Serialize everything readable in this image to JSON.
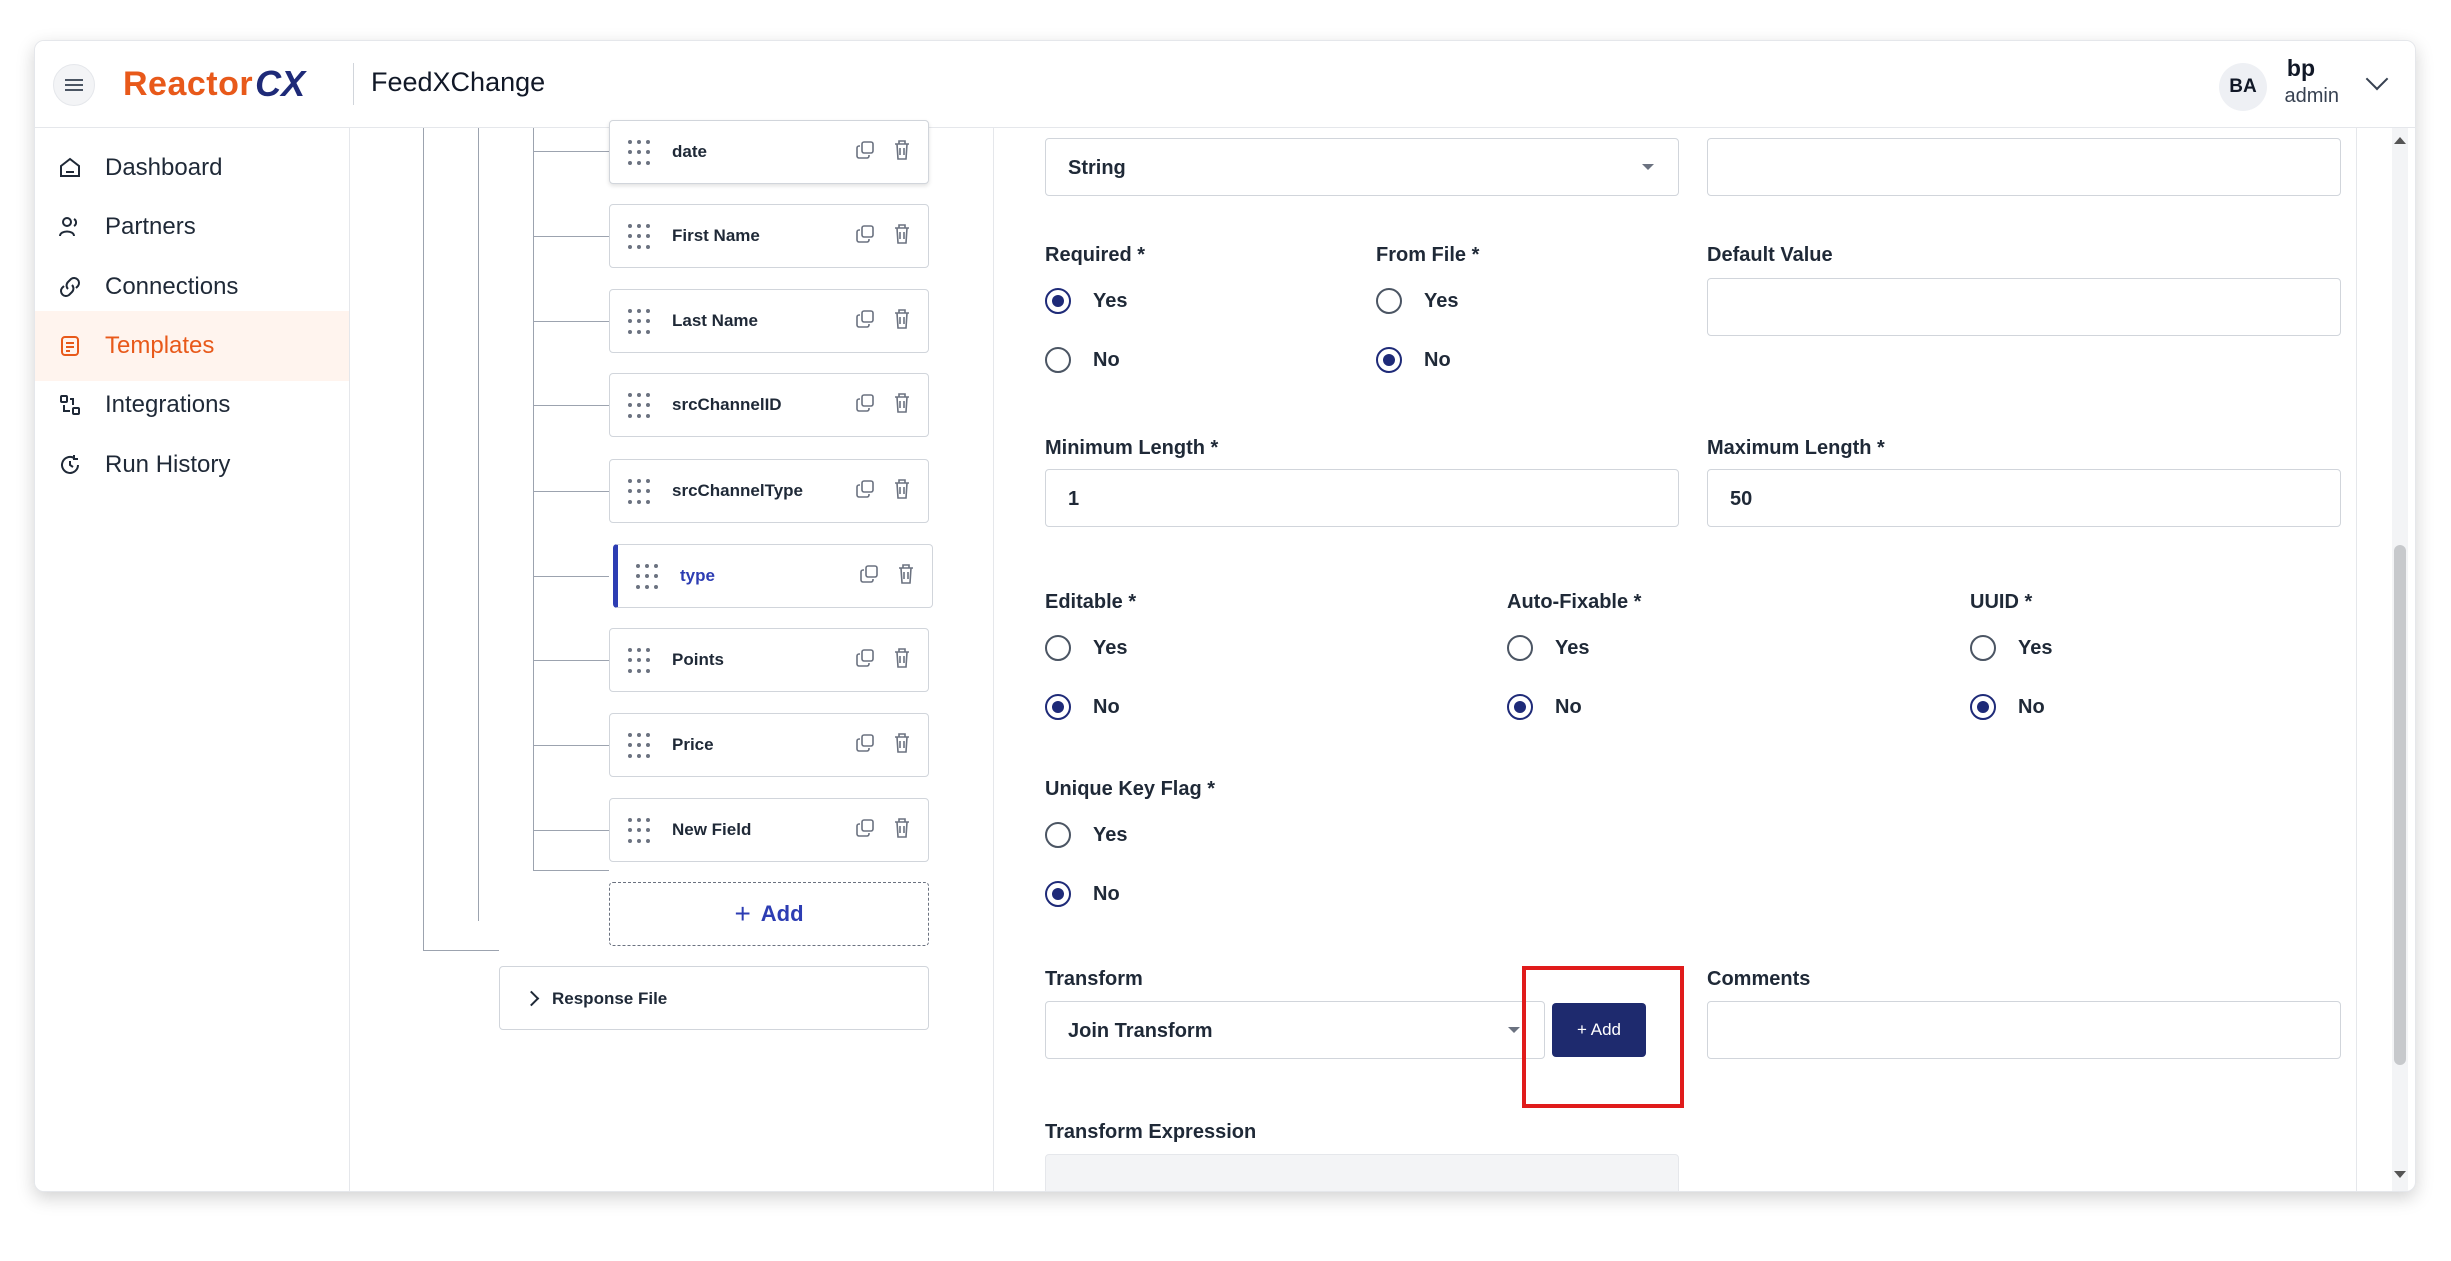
{
  "header": {
    "logo_word": "Reactor",
    "logo_cx": "CX",
    "app_title": "FeedXChange",
    "avatar_initials": "BA",
    "user_name": "bp",
    "user_role": "admin"
  },
  "sidebar": {
    "items": [
      {
        "label": "Dashboard",
        "icon": "home-icon",
        "active": false
      },
      {
        "label": "Partners",
        "icon": "users-icon",
        "active": false
      },
      {
        "label": "Connections",
        "icon": "link-icon",
        "active": false
      },
      {
        "label": "Templates",
        "icon": "template-icon",
        "active": true
      },
      {
        "label": "Integrations",
        "icon": "integrations-icon",
        "active": false
      },
      {
        "label": "Run History",
        "icon": "history-icon",
        "active": false
      }
    ]
  },
  "tree": {
    "fields": [
      {
        "name": "date"
      },
      {
        "name": "First Name"
      },
      {
        "name": "Last Name"
      },
      {
        "name": "srcChannelID"
      },
      {
        "name": "srcChannelType"
      },
      {
        "name": "type",
        "selected": true
      },
      {
        "name": "Points"
      },
      {
        "name": "Price"
      },
      {
        "name": "New Field"
      }
    ],
    "add_label": "Add",
    "response_file_label": "Response File"
  },
  "form": {
    "data_type_value": "String",
    "required": {
      "label": "Required *",
      "yes": "Yes",
      "no": "No",
      "selected": "Yes"
    },
    "from_file": {
      "label": "From File *",
      "yes": "Yes",
      "no": "No",
      "selected": "No"
    },
    "default_value": {
      "label": "Default Value",
      "value": ""
    },
    "min_length": {
      "label": "Minimum Length *",
      "value": "1"
    },
    "max_length": {
      "label": "Maximum Length *",
      "value": "50"
    },
    "editable": {
      "label": "Editable *",
      "yes": "Yes",
      "no": "No",
      "selected": "No"
    },
    "auto_fixable": {
      "label": "Auto-Fixable *",
      "yes": "Yes",
      "no": "No",
      "selected": "No"
    },
    "uuid": {
      "label": "UUID *",
      "yes": "Yes",
      "no": "No",
      "selected": "No"
    },
    "unique_key_flag": {
      "label": "Unique Key Flag *",
      "yes": "Yes",
      "no": "No",
      "selected": "No"
    },
    "transform": {
      "label": "Transform",
      "value": "Join Transform",
      "add_button": "+ Add"
    },
    "comments": {
      "label": "Comments",
      "value": ""
    },
    "transform_expression": {
      "label": "Transform Expression",
      "value": ""
    }
  },
  "colors": {
    "brand_orange": "#e8591a",
    "brand_navy": "#1e2a6e",
    "highlight": "#e01b1b"
  }
}
